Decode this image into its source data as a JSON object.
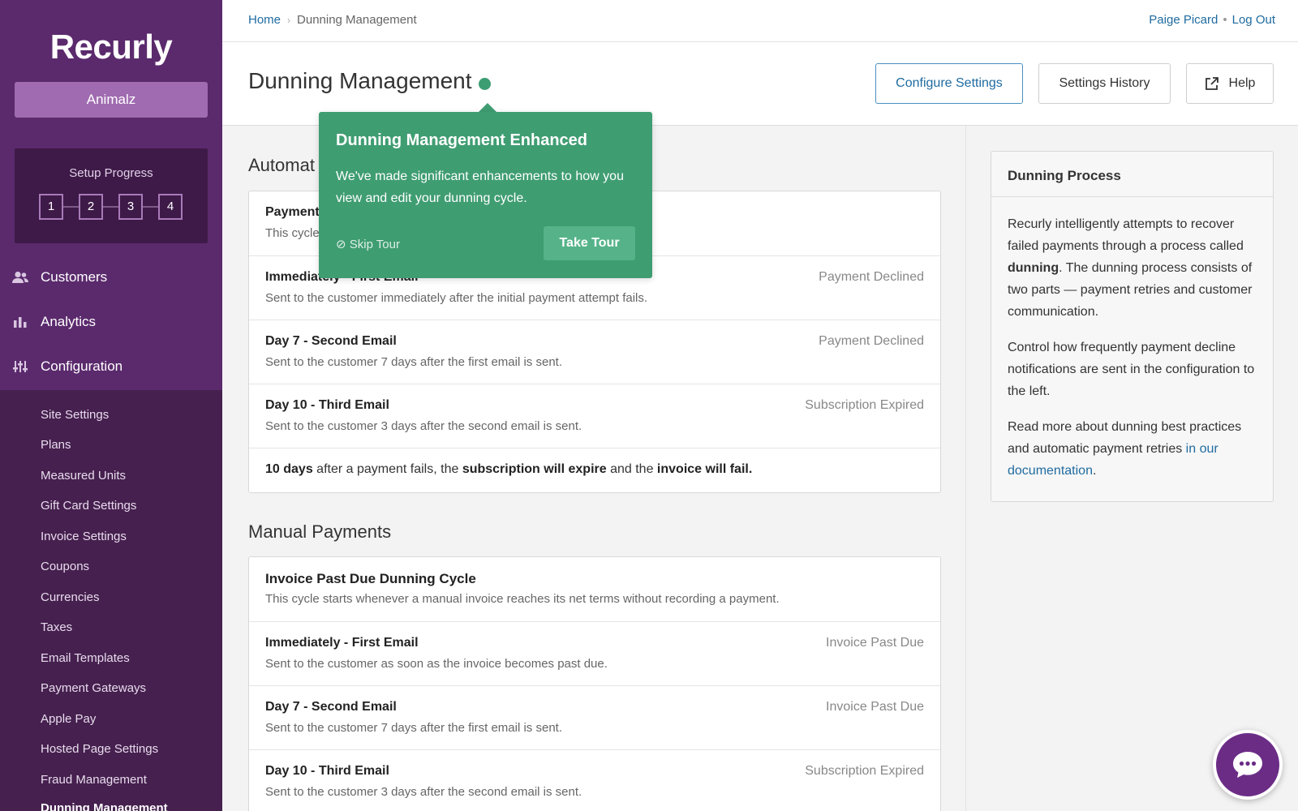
{
  "sidebar": {
    "logo": "Recurly",
    "account": "Animalz",
    "setup": {
      "title": "Setup Progress",
      "steps": [
        "1",
        "2",
        "3",
        "4"
      ]
    },
    "nav": [
      {
        "label": "Customers",
        "icon": "users-icon"
      },
      {
        "label": "Analytics",
        "icon": "bar-chart-icon"
      },
      {
        "label": "Configuration",
        "icon": "sliders-icon"
      }
    ],
    "sub_items": [
      "Site Settings",
      "Plans",
      "Measured Units",
      "Gift Card Settings",
      "Invoice Settings",
      "Coupons",
      "Currencies",
      "Taxes",
      "Email Templates",
      "Payment Gateways",
      "Apple Pay",
      "Hosted Page Settings",
      "Fraud Management",
      "Dunning Management"
    ]
  },
  "topbar": {
    "breadcrumb": {
      "home": "Home",
      "current": "Dunning Management"
    },
    "user": "Paige Picard",
    "logout": "Log Out"
  },
  "header": {
    "title": "Dunning Management",
    "buttons": {
      "configure": "Configure Settings",
      "history": "Settings History",
      "help": "Help"
    }
  },
  "automatic": {
    "title": "Automat",
    "cycle_title": "Payment",
    "cycle_desc": "This cycle",
    "rows": [
      {
        "title": "Immediately - First Email",
        "desc": "Sent to the customer immediately after the initial payment attempt fails.",
        "status": "Payment Declined"
      },
      {
        "title": "Day 7 - Second Email",
        "desc": "Sent to the customer 7 days after the first email is sent.",
        "status": "Payment Declined"
      },
      {
        "title": "Day 10 - Third Email",
        "desc": "Sent to the customer 3 days after the second email is sent.",
        "status": "Subscription Expired"
      }
    ],
    "summary": {
      "a": "10 days",
      "b": " after a payment fails, the ",
      "c": "subscription will expire",
      "d": " and the ",
      "e": "invoice will fail."
    }
  },
  "manual": {
    "title": "Manual Payments",
    "cycle_title": "Invoice Past Due Dunning Cycle",
    "cycle_desc": "This cycle starts whenever a manual invoice reaches its net terms without recording a payment.",
    "rows": [
      {
        "title": "Immediately - First Email",
        "desc": "Sent to the customer as soon as the invoice becomes past due.",
        "status": "Invoice Past Due"
      },
      {
        "title": "Day 7 - Second Email",
        "desc": "Sent to the customer 7 days after the first email is sent.",
        "status": "Invoice Past Due"
      },
      {
        "title": "Day 10 - Third Email",
        "desc": "Sent to the customer 3 days after the second email is sent.",
        "status": "Subscription Expired"
      }
    ]
  },
  "panel": {
    "title": "Dunning Process",
    "p1a": "Recurly intelligently attempts to recover failed payments through a process called ",
    "p1b": "dunning",
    "p1c": ". The dunning process consists of two parts — payment retries and customer communication.",
    "p2": "Control how frequently payment decline notifications are sent in the configuration to the left.",
    "p3a": "Read more about dunning best practices and automatic payment retries ",
    "p3link": "in our documentation",
    "p3b": "."
  },
  "tour": {
    "title": "Dunning Management Enhanced",
    "body": "We've made significant enhancements to how you view and edit your dunning cycle.",
    "skip": "⊘ Skip Tour",
    "take": "Take Tour"
  },
  "colors": {
    "sidebar": "#5b2a6d",
    "accent_green": "#3f9d72",
    "link": "#1f6ba0"
  }
}
